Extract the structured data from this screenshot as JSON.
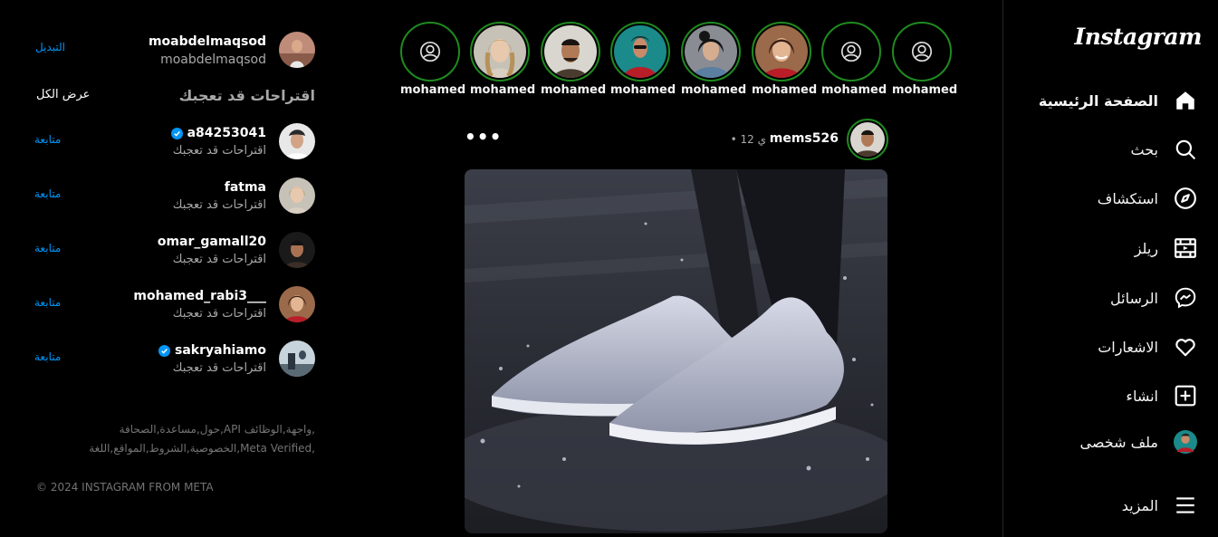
{
  "nav": {
    "logo": "Instagram",
    "items": [
      {
        "label": "الصفحة الرئيسية",
        "icon": "home-icon"
      },
      {
        "label": "بحث",
        "icon": "search-icon"
      },
      {
        "label": "استكشاف",
        "icon": "compass-icon"
      },
      {
        "label": "ريلز",
        "icon": "reels-icon"
      },
      {
        "label": "الرسائل",
        "icon": "messenger-icon"
      },
      {
        "label": "الاشعارات",
        "icon": "heart-icon"
      },
      {
        "label": "انشاء",
        "icon": "create-icon"
      },
      {
        "label": "ملف شخصى",
        "icon": "profile-avatar"
      },
      {
        "label": "المزيد",
        "icon": "menu-icon"
      }
    ]
  },
  "stories": [
    {
      "name": "mohamed"
    },
    {
      "name": "mohamed"
    },
    {
      "name": "mohamed"
    },
    {
      "name": "mohamed"
    },
    {
      "name": "mohamed"
    },
    {
      "name": "mohamed"
    },
    {
      "name": "mohamed"
    },
    {
      "name": "mohamed"
    }
  ],
  "post": {
    "username": "mems526",
    "time": "• ي 12",
    "more": "•••"
  },
  "me": {
    "username": "moabdelmaqsod",
    "subtitle": "moabdelmaqsod",
    "switch": "التبديل"
  },
  "suggestions": {
    "title": "اقتراحات قد تعجبك",
    "see_all": "عرض الكل",
    "items": [
      {
        "name": "a84253041",
        "verified": true,
        "subtitle": "اقتراحات قد تعجبك",
        "action": "متابعة"
      },
      {
        "name": "fatma",
        "verified": false,
        "subtitle": "اقتراحات قد تعجبك",
        "action": "متابعة"
      },
      {
        "name": "omar_gamall20",
        "verified": false,
        "subtitle": "اقتراحات قد تعجبك",
        "action": "متابعة"
      },
      {
        "name": "mohamed_rabi3___",
        "verified": false,
        "subtitle": "اقتراحات قد تعجبك",
        "action": "متابعة"
      },
      {
        "name": "sakryahiamo",
        "verified": true,
        "subtitle": "اقتراحات قد تعجبك",
        "action": "متابعة"
      }
    ]
  },
  "footer": {
    "line1": "حول,مساعدة,الصحافة,API واجهة,الوظائف,",
    "line2": "الخصوصية,الشروط,المواقع,اللغة,Meta Verified,",
    "copyright": "© 2024 INSTAGRAM FROM META"
  },
  "colors": {
    "accent": "#0095f6",
    "story_ring": "#1f8a1f",
    "verified": "#0095f6"
  }
}
